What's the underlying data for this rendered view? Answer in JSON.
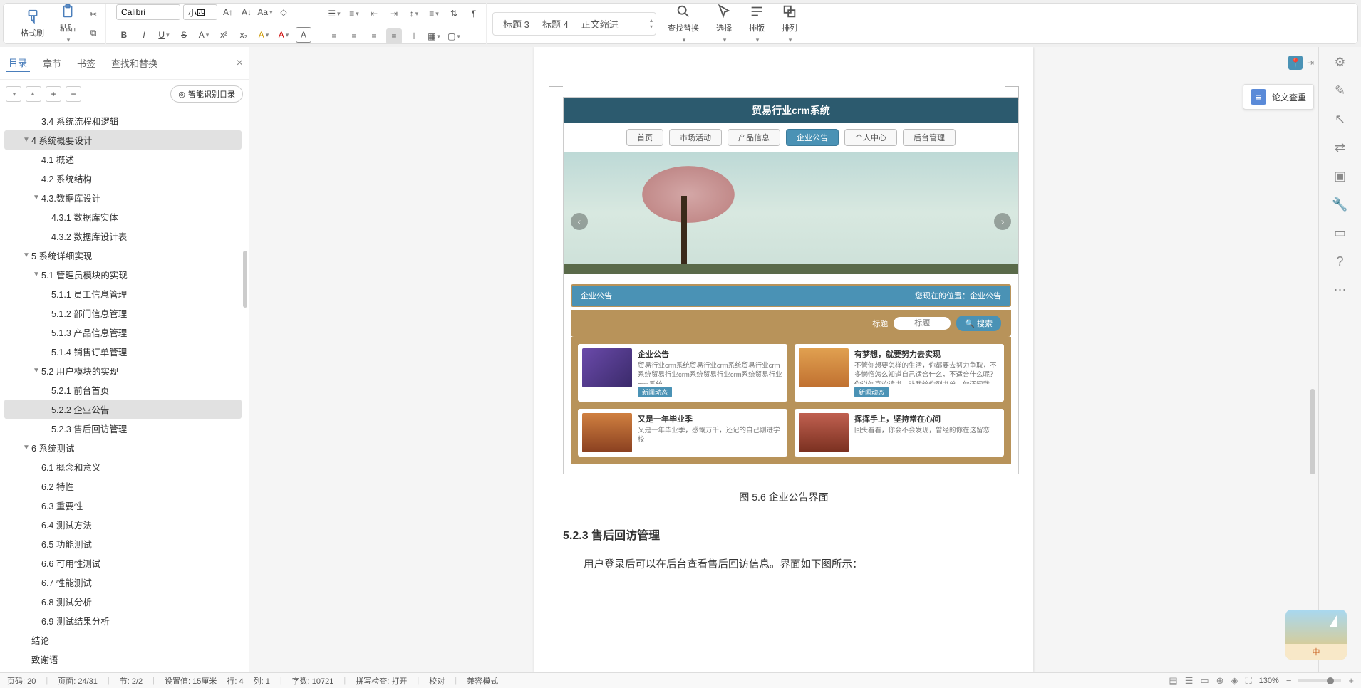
{
  "ribbon": {
    "formatBrush": "格式刷",
    "paste": "粘贴",
    "fontName": "Calibri",
    "fontSize": "小四",
    "styles": [
      "标题 3",
      "标题 4",
      "正文缩进"
    ],
    "findReplace": "查找替换",
    "select": "选择",
    "layout": "排版",
    "arrange": "排列"
  },
  "outline": {
    "tabs": [
      "目录",
      "章节",
      "书签",
      "查找和替换"
    ],
    "smart": "智能识别目录",
    "items": [
      {
        "lv": 2,
        "tw": "",
        "txt": "3.4 系统流程和逻辑",
        "sel": false
      },
      {
        "lv": 1,
        "tw": "▼",
        "txt": "4 系统概要设计",
        "sel": true
      },
      {
        "lv": 2,
        "tw": "",
        "txt": "4.1 概述",
        "sel": false
      },
      {
        "lv": 2,
        "tw": "",
        "txt": "4.2 系统结构",
        "sel": false
      },
      {
        "lv": 2,
        "tw": "▼",
        "txt": "4.3.数据库设计",
        "sel": false
      },
      {
        "lv": 3,
        "tw": "",
        "txt": "4.3.1 数据库实体",
        "sel": false
      },
      {
        "lv": 3,
        "tw": "",
        "txt": "4.3.2 数据库设计表",
        "sel": false
      },
      {
        "lv": 1,
        "tw": "▼",
        "txt": "5 系统详细实现",
        "sel": false
      },
      {
        "lv": 2,
        "tw": "▼",
        "txt": "5.1  管理员模块的实现",
        "sel": false
      },
      {
        "lv": 3,
        "tw": "",
        "txt": "5.1.1 员工信息管理",
        "sel": false
      },
      {
        "lv": 3,
        "tw": "",
        "txt": "5.1.2 部门信息管理",
        "sel": false
      },
      {
        "lv": 3,
        "tw": "",
        "txt": "5.1.3 产品信息管理",
        "sel": false
      },
      {
        "lv": 3,
        "tw": "",
        "txt": "5.1.4 销售订单管理",
        "sel": false
      },
      {
        "lv": 2,
        "tw": "▼",
        "txt": "5.2  用户模块的实现",
        "sel": false
      },
      {
        "lv": 3,
        "tw": "",
        "txt": "5.2.1 前台首页",
        "sel": false
      },
      {
        "lv": 3,
        "tw": "",
        "txt": "5.2.2 企业公告",
        "sel": true
      },
      {
        "lv": 3,
        "tw": "",
        "txt": "5.2.3 售后回访管理",
        "sel": false
      },
      {
        "lv": 1,
        "tw": "▼",
        "txt": "6 系统测试",
        "sel": false
      },
      {
        "lv": 2,
        "tw": "",
        "txt": "6.1 概念和意义",
        "sel": false
      },
      {
        "lv": 2,
        "tw": "",
        "txt": "6.2 特性",
        "sel": false
      },
      {
        "lv": 2,
        "tw": "",
        "txt": "6.3 重要性",
        "sel": false
      },
      {
        "lv": 2,
        "tw": "",
        "txt": "6.4 测试方法",
        "sel": false
      },
      {
        "lv": 2,
        "tw": "",
        "txt": "6.5 功能测试",
        "sel": false
      },
      {
        "lv": 2,
        "tw": "",
        "txt": "6.6 可用性测试",
        "sel": false
      },
      {
        "lv": 2,
        "tw": "",
        "txt": "6.7 性能测试",
        "sel": false
      },
      {
        "lv": 2,
        "tw": "",
        "txt": "6.8 测试分析",
        "sel": false
      },
      {
        "lv": 2,
        "tw": "",
        "txt": "6.9 测试结果分析",
        "sel": false
      },
      {
        "lv": 1,
        "tw": "",
        "txt": "结论",
        "sel": false
      },
      {
        "lv": 1,
        "tw": "",
        "txt": "致谢语",
        "sel": false
      }
    ]
  },
  "doc": {
    "site": {
      "title": "贸易行业crm系统",
      "nav": [
        "首页",
        "市场活动",
        "产品信息",
        "企业公告",
        "个人中心",
        "后台管理"
      ],
      "navActive": 3,
      "secTitle": "企业公告",
      "breadcrumb": "您现在的位置：企业公告",
      "searchLabel": "标题",
      "searchPlaceholder": "标题",
      "searchBtn": "搜索",
      "cards": [
        {
          "tit": "企业公告",
          "desc": "贸易行业crm系统贸易行业crm系统贸易行业crm系统贸易行业crm系统贸易行业crm系统贸易行业crm系统",
          "tag": "新闻动态",
          "th": "t1"
        },
        {
          "tit": "有梦想，就要努力去实现",
          "desc": "不管你想要怎样的生活，你都要去努力争取，不多懒惰怎么知道自己适合什么，不适合什么呢？你说你喜欢读书，让我给你列书单，你还问我",
          "tag": "新闻动态",
          "th": "t2"
        },
        {
          "tit": "又是一年毕业季",
          "desc": "又是一年毕业季，感慨万千，还记的自己刚进学校",
          "tag": "",
          "th": "t3"
        },
        {
          "tit": "挥挥手上，坚持常在心间",
          "desc": "回头看看，你会不会发现，曾经的你在这留恋",
          "tag": "",
          "th": "t4"
        }
      ]
    },
    "figcap": "图 5.6  企业公告界面",
    "heading": "5.2.3  售后回访管理",
    "para": "用户登录后可以在后台查看售后回访信息。界面如下图所示："
  },
  "right": {
    "paperCheck": "论文查重"
  },
  "status": {
    "pageSection": "页码: 20",
    "pageCount": "页面: 24/31",
    "section": "节: 2/2",
    "pos": "设置值: 15厘米",
    "line": "行: 4",
    "col": "列: 1",
    "words": "字数: 10721",
    "spell": "拼写检查: 打开",
    "proof": "校对",
    "compat": "兼容模式",
    "zoom": "130%"
  },
  "promo": "中"
}
